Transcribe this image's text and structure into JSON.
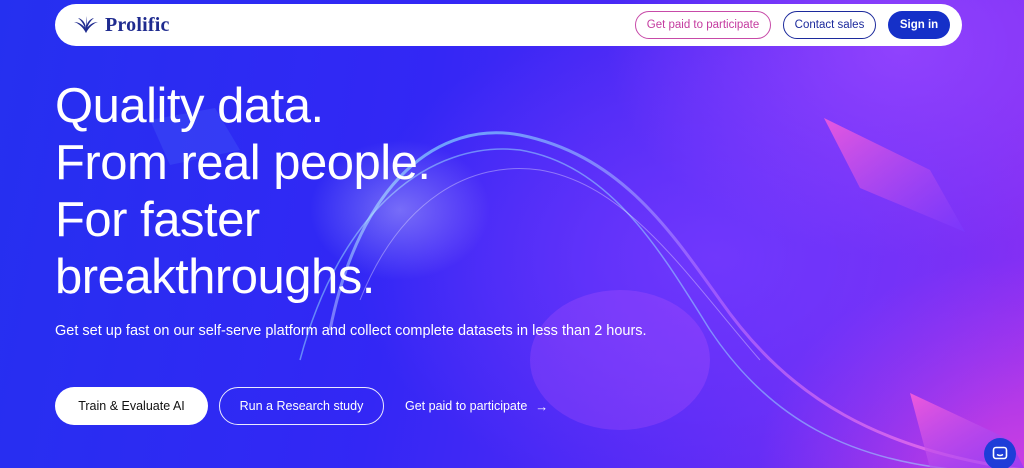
{
  "nav": {
    "logo_text": "Prolific",
    "paid_label": "Get paid to participate",
    "contact_label": "Contact sales",
    "signin_label": "Sign in"
  },
  "hero": {
    "headline_lines": [
      "Quality data.",
      "From real people.",
      "For faster",
      "breakthroughs."
    ],
    "subtitle": "Get set up fast on our self-serve platform and collect complete datasets in less than 2 hours.",
    "cta_train": "Train & Evaluate AI",
    "cta_research": "Run a Research study",
    "cta_paid": "Get paid to participate",
    "cta_paid_arrow": "→"
  },
  "colors": {
    "brand_navy": "#1f2b8f",
    "signin_bg": "#1530c8",
    "paid_pink": "#c43b9f",
    "hero_blue": "#2b2df2",
    "hero_purple": "#8a2ef2"
  },
  "icons": {
    "logo": "prolific-logo-icon",
    "arrow": "arrow-right-icon",
    "chat": "chat-bubble-icon"
  }
}
